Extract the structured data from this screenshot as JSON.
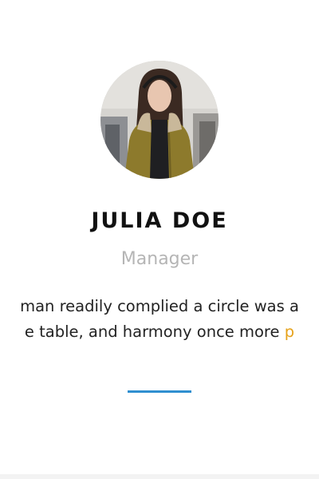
{
  "profile": {
    "name": "JULIA DOE",
    "role": "Manager",
    "quote_line1": "man readily complied a circle was a",
    "quote_line2_main": "e table, and harmony once more ",
    "quote_line2_accent": "p"
  },
  "colors": {
    "name": "#111111",
    "role": "#b5b5b5",
    "text": "#222222",
    "accent_text": "#e6a21a",
    "divider": "#2f8fd0"
  }
}
